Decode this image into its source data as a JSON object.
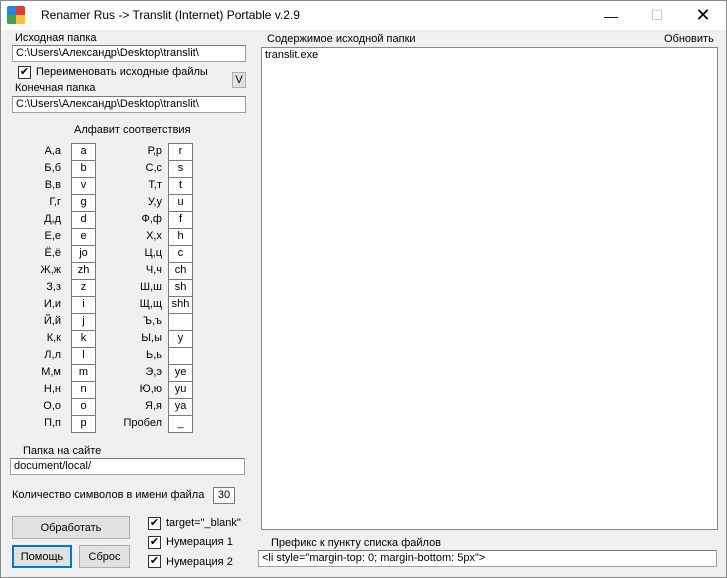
{
  "window": {
    "title": "Renamer Rus -> Translit (Internet) Portable v.2.9",
    "minimize_glyph": "—",
    "maximize_glyph": "☐",
    "close_glyph": "✕"
  },
  "source": {
    "label": "Исходная папка",
    "value": "C:\\Users\\Александр\\Desktop\\translit\\"
  },
  "rename_original": {
    "checked_glyph": "✔",
    "label": "Переименовать исходные файлы"
  },
  "v_button": {
    "label": "V"
  },
  "dest": {
    "label": "Конечная папка",
    "value": "C:\\Users\\Александр\\Desktop\\translit\\"
  },
  "alphabet": {
    "title": "Алфавит соответствия",
    "left": [
      {
        "ru": "А,а",
        "lat": "a"
      },
      {
        "ru": "Б,б",
        "lat": "b"
      },
      {
        "ru": "В,в",
        "lat": "v"
      },
      {
        "ru": "Г,г",
        "lat": "g"
      },
      {
        "ru": "Д,д",
        "lat": "d"
      },
      {
        "ru": "Е,е",
        "lat": "e"
      },
      {
        "ru": "Ё,ё",
        "lat": "jo"
      },
      {
        "ru": "Ж,ж",
        "lat": "zh"
      },
      {
        "ru": "З,з",
        "lat": "z"
      },
      {
        "ru": "И,и",
        "lat": "i"
      },
      {
        "ru": "Й,й",
        "lat": "j"
      },
      {
        "ru": "К,к",
        "lat": "k"
      },
      {
        "ru": "Л,л",
        "lat": "l"
      },
      {
        "ru": "М,м",
        "lat": "m"
      },
      {
        "ru": "Н,н",
        "lat": "n"
      },
      {
        "ru": "О,о",
        "lat": "o"
      },
      {
        "ru": "П,п",
        "lat": "p"
      }
    ],
    "right": [
      {
        "ru": "Р,р",
        "lat": "r"
      },
      {
        "ru": "С,с",
        "lat": "s"
      },
      {
        "ru": "Т,т",
        "lat": "t"
      },
      {
        "ru": "У,у",
        "lat": "u"
      },
      {
        "ru": "Ф,ф",
        "lat": "f"
      },
      {
        "ru": "Х,х",
        "lat": "h"
      },
      {
        "ru": "Ц,ц",
        "lat": "c"
      },
      {
        "ru": "Ч,ч",
        "lat": "ch"
      },
      {
        "ru": "Ш,ш",
        "lat": "sh"
      },
      {
        "ru": "Щ,щ",
        "lat": "shh"
      },
      {
        "ru": "Ъ,ъ",
        "lat": ""
      },
      {
        "ru": "Ы,ы",
        "lat": "y"
      },
      {
        "ru": "Ь,ь",
        "lat": ""
      },
      {
        "ru": "Э,э",
        "lat": "ye"
      },
      {
        "ru": "Ю,ю",
        "lat": "yu"
      },
      {
        "ru": "Я,я",
        "lat": "ya"
      },
      {
        "ru": "Пробел",
        "lat": "_"
      }
    ]
  },
  "site_folder": {
    "label": "Папка на сайте",
    "value": "document/local/"
  },
  "char_count": {
    "label": "Количество символов в имени файла",
    "value": "30"
  },
  "buttons": {
    "process": "Обработать",
    "help": "Помощь",
    "reset": "Сброс"
  },
  "options": {
    "checked_glyph": "✔",
    "target_blank": "target=\"_blank\"",
    "numbering1": "Нумерация 1",
    "numbering2": "Нумерация 2"
  },
  "folder_contents": {
    "label": "Содержимое исходной папки",
    "refresh": "Обновить",
    "files": [
      "translit.exe"
    ]
  },
  "prefix": {
    "label": "Префикс к пункту списка файлов",
    "value": "<li style=\"margin-top: 0; margin-bottom: 5px\">"
  }
}
